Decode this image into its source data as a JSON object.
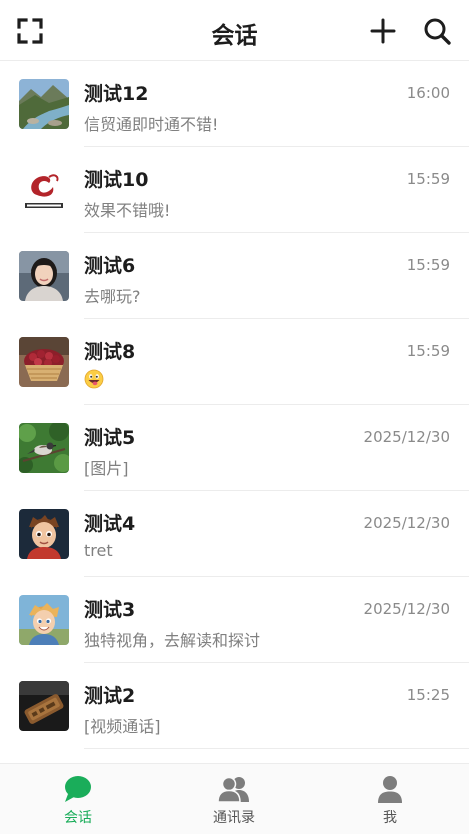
{
  "header": {
    "title": "会话"
  },
  "conversations": [
    {
      "name": "测试12",
      "time": "16:00",
      "preview": "信贸通即时通不错!",
      "avatar": "landscape-river-image"
    },
    {
      "name": "测试10",
      "time": "15:59",
      "preview": "效果不错哦!",
      "avatar": "semut-logo"
    },
    {
      "name": "测试6",
      "time": "15:59",
      "preview": "去哪玩?",
      "avatar": "woman-portrait-photo"
    },
    {
      "name": "测试8",
      "time": "15:59",
      "preview": "",
      "preview_emoji": "grinning-tongue-emoji",
      "avatar": "cherries-basket-photo"
    },
    {
      "name": "测试5",
      "time": "2025/12/30",
      "preview": "[图片]",
      "avatar": "bird-on-branch-photo"
    },
    {
      "name": "测试4",
      "time": "2025/12/30",
      "preview": "tret",
      "avatar": "cartoon-boy-image"
    },
    {
      "name": "测试3",
      "time": "2025/12/30",
      "preview": "独特视角，去解读和探讨",
      "avatar": "cartoon-child-image"
    },
    {
      "name": "测试2",
      "time": "15:25",
      "preview": "[视频通话]",
      "avatar": "wooden-object-photo"
    }
  ],
  "tabbar": {
    "tabs": [
      {
        "label": "会话",
        "icon": "chat-bubble-icon",
        "active": true
      },
      {
        "label": "通讯录",
        "icon": "contacts-icon",
        "active": false
      },
      {
        "label": "我",
        "icon": "person-icon",
        "active": false
      }
    ]
  },
  "colors": {
    "accent": "#1aad5a",
    "inactive_icon": "#7d7d7d",
    "text_primary": "#1d1d1d",
    "text_secondary": "#808080"
  }
}
